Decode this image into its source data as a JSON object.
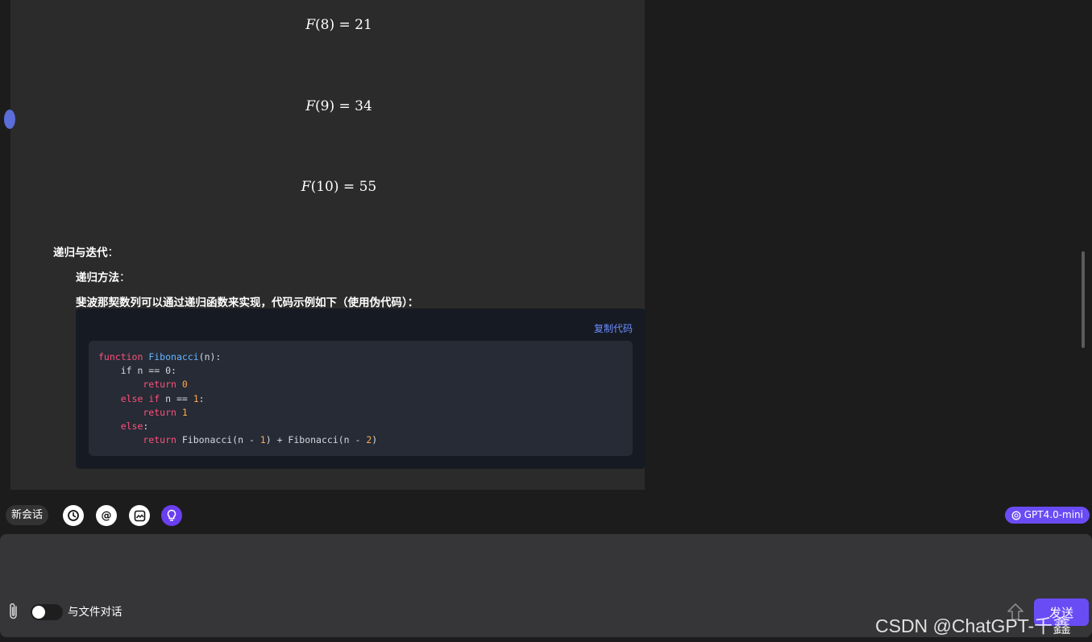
{
  "math": [
    {
      "fn": "F",
      "arg": "(8)",
      "eq": " = ",
      "value": "21"
    },
    {
      "fn": "F",
      "arg": "(9)",
      "eq": " = ",
      "value": "34"
    },
    {
      "fn": "F",
      "arg": "(10)",
      "eq": " = ",
      "value": "55"
    }
  ],
  "section": {
    "heading": "递归与迭代",
    "sub_heading": "递归方法",
    "colon": "：",
    "description": "斐波那契数列可以通过递归函数来实现，代码示例如下（使用伪代码）："
  },
  "code_block": {
    "copy_label": "复制代码",
    "lines": {
      "l1_kw": "function",
      "l1_name": "Fibonacci",
      "l1_rest": "(n):",
      "l2": "    if n == 0:",
      "l3_kw": "        return",
      "l3_num": "0",
      "l4_kw1": "    else",
      "l4_kw2": "if",
      "l4_rest": " n == ",
      "l4_num": "1",
      "l4_end": ":",
      "l5_kw": "        return",
      "l5_num": "1",
      "l6_kw": "    else",
      "l6_end": ":",
      "l7_kw": "        return",
      "l7_a": " Fibonacci(n - ",
      "l7_n1": "1",
      "l7_b": ") + Fibonacci(n - ",
      "l7_n2": "2",
      "l7_c": ")"
    }
  },
  "toolbar": {
    "new_chat_label": "新会话",
    "at_symbol": "@",
    "model_label": "GPT4.0-mini"
  },
  "input": {
    "toggle_label": "与文件对话",
    "send_label": "发送"
  },
  "watermark": "CSDN @ChatGPT-千鑫",
  "colors": {
    "accent": "#6a4cf5",
    "link": "#6c8cff",
    "keyword": "#ff4f7b",
    "function_name": "#66b4ff",
    "number": "#ffa94d"
  }
}
